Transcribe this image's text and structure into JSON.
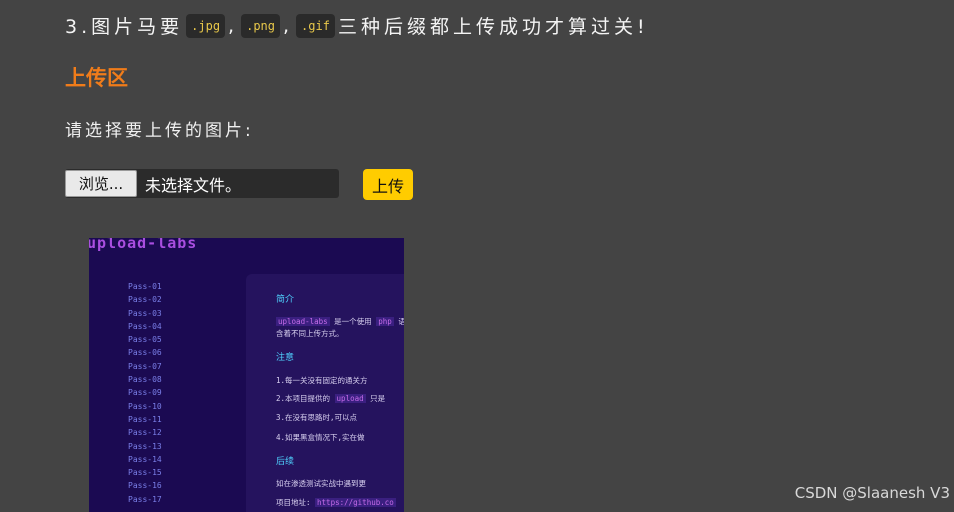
{
  "rule": {
    "prefix": "3.图片马要",
    "ext1": ".jpg",
    "sep1": ",",
    "ext2": ".png",
    "sep2": ",",
    "ext3": ".gif",
    "suffix": "三种后缀都上传成功才算过关!"
  },
  "section_title": "上传区",
  "prompt": "请选择要上传的图片:",
  "file_input": {
    "browse_label": "浏览...",
    "status_text": "未选择文件。"
  },
  "upload_button": "上传",
  "preview": {
    "logo": "upload-labs",
    "nav": [
      "Pass-01",
      "Pass-02",
      "Pass-03",
      "Pass-04",
      "Pass-05",
      "Pass-06",
      "Pass-07",
      "Pass-08",
      "Pass-09",
      "Pass-10",
      "Pass-11",
      "Pass-12",
      "Pass-13",
      "Pass-14",
      "Pass-15",
      "Pass-16",
      "Pass-17"
    ],
    "heading_intro": "简介",
    "intro_line1_code": "upload-labs",
    "intro_line1_text": " 是一个使用 ",
    "intro_line1_code2": "php",
    "intro_line1_tail": " 语",
    "intro_line2": "含着不同上传方式。",
    "heading_note": "注意",
    "note1": "1.每一关没有固定的通关方",
    "note2_head": "2.本项目提供的 ",
    "note2_code": "upload",
    "note2_tail": " 只是",
    "note3": "3.在没有思路时,可以点",
    "note4": "4.如果黑盒情况下,实在做",
    "heading_thanks": "后续",
    "thanks1": "如在渗透测试实战中遇到更",
    "thanks2_head": "项目地址: ",
    "thanks2_link": "https://github.co"
  },
  "watermark": "CSDN @Slaanesh V3"
}
